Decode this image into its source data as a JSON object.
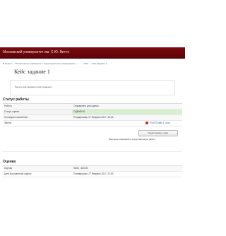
{
  "header": {
    "site_title": "Московский университет им. С.Ю. Витте"
  },
  "breadcrumb": {
    "text": "В начало → Региональное управление и территориальное планирование → ... → Кейс → Кейс задание 1"
  },
  "page": {
    "title": "Кейс задание 1",
    "intro": "Решите два задания к кейс заданию 1"
  },
  "status": {
    "title": "Статус работы",
    "rows": [
      {
        "label": "Работа",
        "value": "Отправлено для оценки"
      },
      {
        "label": "Статус оценки",
        "value": "ОЦЕНЕНО"
      },
      {
        "label": "Последнее изменение",
        "value": "Понедельник, 27 Февраль 2017, 15:43"
      },
      {
        "label": "Файлы",
        "value": "РУиТП Кейс 1 .docx"
      }
    ],
    "edit_button": "Редактировать ответ",
    "edit_note": "Внесение изменений в представленную работу"
  },
  "grade": {
    "title": "Оценка",
    "rows": [
      {
        "label": "Оценка",
        "value": "95,00 / 100,00"
      },
      {
        "label": "Дата выставления оценки",
        "value": "Понедельник, 27 Февраль 2017, 22:53"
      }
    ]
  },
  "colors": {
    "header_band": "#6a0710",
    "graded_highlight": "#d9efcf"
  },
  "icons": {
    "file": "document-icon"
  }
}
